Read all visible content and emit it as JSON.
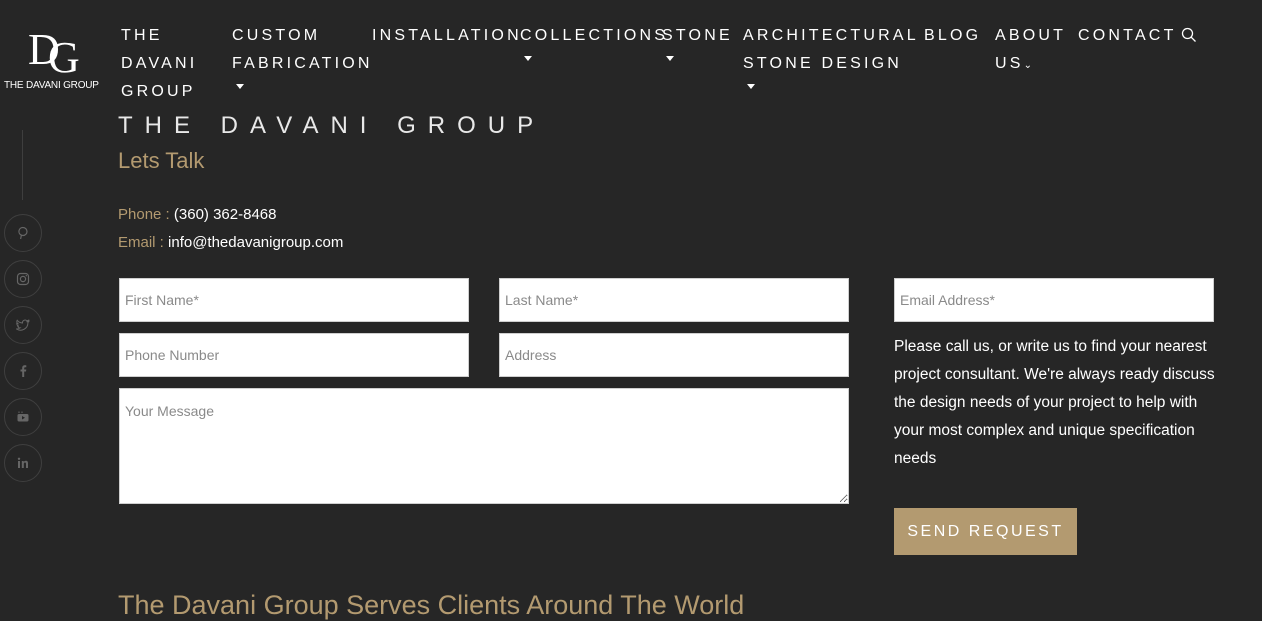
{
  "logo": {
    "monogram_d": "D",
    "monogram_g": "G",
    "text": "THE DAVANI GROUP"
  },
  "nav": {
    "items": [
      {
        "label": "THE DAVANI GROUP"
      },
      {
        "label": "CUSTOM FABRICATION"
      },
      {
        "label": "INSTALLATION"
      },
      {
        "label": "COLLECTIONS"
      },
      {
        "label": "STONE"
      },
      {
        "label": "ARCHITECTURAL STONE DESIGN"
      },
      {
        "label": "BLOG"
      },
      {
        "label": "ABOUT US"
      },
      {
        "label": "CONTACT"
      }
    ],
    "search_icon": "search-icon"
  },
  "social": [
    "pinterest-icon",
    "instagram-icon",
    "twitter-icon",
    "facebook-icon",
    "youtube-icon",
    "linkedin-icon"
  ],
  "content": {
    "brand_heading": "THE DAVANI GROUP",
    "subheading": "Lets Talk",
    "phone_label": "Phone : ",
    "phone_value": "(360) 362-8468",
    "email_label": "Email : ",
    "email_value": "info@thedavanigroup.com"
  },
  "form": {
    "first_name_placeholder": "First Name*",
    "last_name_placeholder": "Last Name*",
    "email_placeholder": "Email Address*",
    "phone_placeholder": "Phone Number",
    "address_placeholder": "Address",
    "message_placeholder": "Your Message",
    "info_text": "Please call us, or write us to find your nearest project consultant. We're always ready discuss the design needs of your project to help with your most complex and unique specification needs",
    "submit_label": "SEND REQUEST"
  },
  "footer_heading": "The Davani Group Serves Clients Around The World",
  "colors": {
    "background": "#262626",
    "accent": "#b39a70",
    "text": "#ffffff"
  }
}
